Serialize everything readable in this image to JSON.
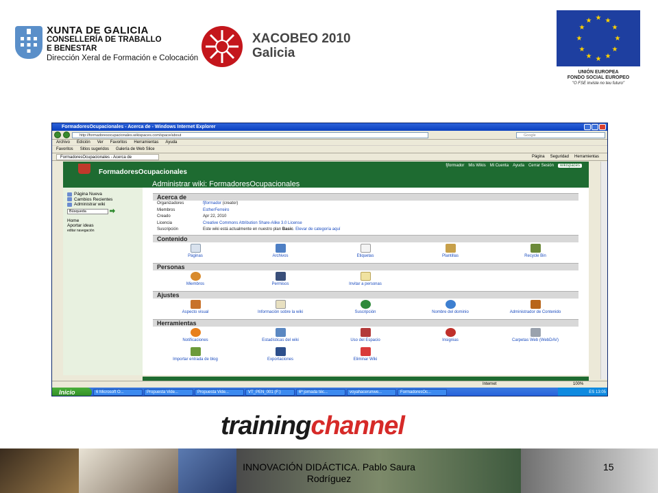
{
  "header": {
    "xunta": {
      "title": "XUNTA DE GALICIA",
      "line2": "CONSELLERÍA DE TRABALLO",
      "line3": "E BENESTAR",
      "line4": "Dirección Xeral de Formación e Colocación"
    },
    "xacobeo": {
      "line1": "XACOBEO 2010",
      "line2": "Galicia"
    },
    "eu": {
      "line1": "UNIÓN EUROPEA",
      "line2": "FONDO SOCIAL EUROPEO",
      "line3": "\"O FSE inviste no teu futuro\""
    }
  },
  "browser": {
    "window_title": "FormadoresOcupacionales - Acerca de - Windows Internet Explorer",
    "address": "http://formadoresocupacionales.wikispaces.com/space/about",
    "search_placeholder": "Google",
    "menu": [
      "Archivo",
      "Edición",
      "Ver",
      "Favoritos",
      "Herramientas",
      "Ayuda"
    ],
    "favbar": {
      "favoritos": "Favoritos",
      "sitios": "Sitios sugeridos",
      "galeria": "Galería de Web Slice"
    },
    "tab_label": "FormadoresOcupacionales - Acerca de",
    "tab_tools": [
      "Página",
      "Seguridad",
      "Herramientas"
    ],
    "status_zone": "Internet",
    "zoom": "100%"
  },
  "wiki": {
    "site_name": "FormadoresOcupacionales",
    "admin_title": "Administrar wiki: FormadoresOcupacionales",
    "top_links": [
      "fjformador",
      "Mis Wikis",
      "Mi Cuenta",
      "Ayuda",
      "Cerrar Sesión"
    ],
    "badge": "wikispaces",
    "sidebar": {
      "items": [
        "Página Nueva",
        "Cambios Recientes",
        "Administrar wiki"
      ],
      "search_value": "Búsqueda",
      "links": [
        "Home",
        "Aportar ideas"
      ],
      "edit_nav": "editar navegación"
    },
    "about": {
      "heading": "Acerca de",
      "rows": [
        {
          "k": "Organizadores",
          "link": "fjformador",
          "rest": " (creator)"
        },
        {
          "k": "Miembros",
          "link": "EstherFerreiro",
          "rest": ""
        },
        {
          "k": "Creado",
          "link": "",
          "rest": "Apr 22, 2010"
        },
        {
          "k": "Licencia",
          "link": "Creative Commons Attribution Share-Alike 3.0 License",
          "rest": ""
        }
      ],
      "subs_label": "Suscripción",
      "subs_text": "Este wiki está actualmente en nuestro plan ",
      "subs_plan": "Basic",
      "subs_link": ". Elevar de categoría aquí"
    },
    "sections": [
      {
        "heading": "Contenido",
        "items": [
          "Páginas",
          "Archivos",
          "Etiquetas",
          "Plantillas",
          "Recycle Bin"
        ]
      },
      {
        "heading": "Personas",
        "items": [
          "Miembros",
          "Permisos",
          "Invitar a personas"
        ]
      },
      {
        "heading": "Ajustes",
        "items": [
          "Aspecto visual",
          "Información sobre la wiki",
          "Suscripción",
          "Nombre del dominio",
          "Administrador de Contenido"
        ]
      },
      {
        "heading": "Herramientas",
        "items": [
          "Notificaciones",
          "Estadísticas del wiki",
          "Uso del Espacio",
          "Insignias",
          "Carpetas Web (WebDAV)"
        ],
        "items2": [
          "Importar entrada de blog",
          "Exportaciones",
          "Eliminar Wiki"
        ]
      }
    ]
  },
  "taskbar": {
    "start": "Inicio",
    "buttons": [
      "6 Microsoft O...",
      "Propuesta Vide...",
      "Propuesta Vide...",
      "VT_PEN_001 (F:)",
      "6ª jornada téc...",
      "voyahacerunwe...",
      "FormadoresOc..."
    ],
    "lang": "ES",
    "clock": "13:05"
  },
  "branding": {
    "training": "training",
    "channel": "channel"
  },
  "footer": {
    "text": "INNOVACIÓN DIDÁCTICA. Pablo Saura Rodríguez",
    "page": "15"
  },
  "colors": {
    "wiki_green": "#1e6b31",
    "link_blue": "#1b4cbf",
    "xp_blue": "#245edb",
    "tc_red": "#d62a28"
  }
}
